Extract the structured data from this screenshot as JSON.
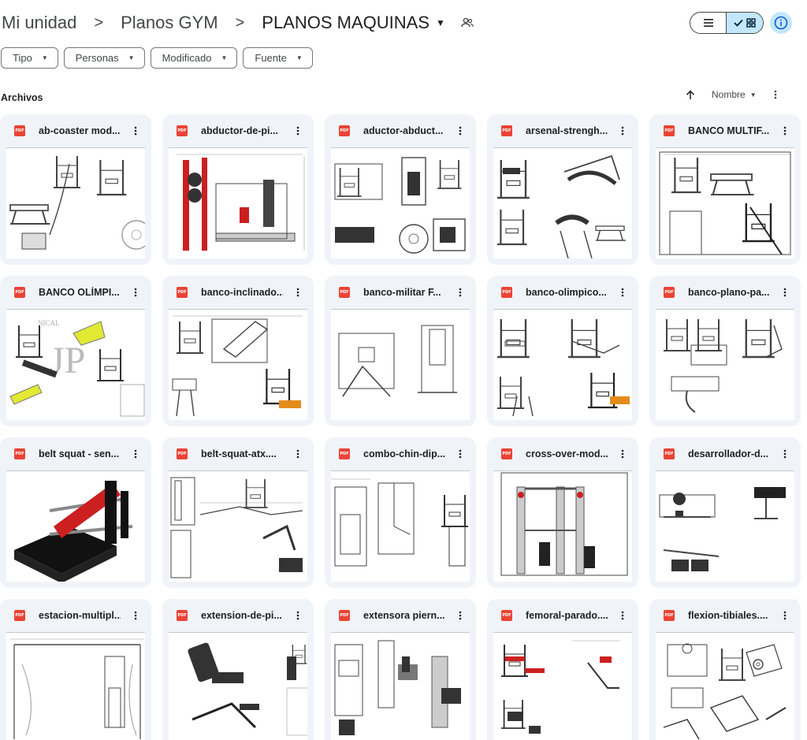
{
  "breadcrumb": {
    "items": [
      "Mi unidad",
      "Planos GYM",
      "PLANOS MAQUINAS"
    ],
    "separator": ">"
  },
  "view": {
    "mode": "grid",
    "list_icon": "list-icon",
    "grid_icon": "grid-icon",
    "check_icon": "check-icon",
    "info_icon": "info-icon"
  },
  "filters": [
    {
      "label": "Tipo"
    },
    {
      "label": "Personas"
    },
    {
      "label": "Modificado"
    },
    {
      "label": "Fuente"
    }
  ],
  "section": {
    "title": "Archivos"
  },
  "sort": {
    "label": "Nombre",
    "direction_icon": "arrow-up-icon"
  },
  "colors": {
    "accent": "#c2e7ff",
    "card_bg": "#f0f4f9",
    "pdf_red": "#ea4335",
    "machine_red": "#cc1f1f",
    "yellow": "#e1e933",
    "orange": "#e38c1b"
  },
  "files": [
    {
      "name": "ab-coaster mod...",
      "type": "PDF",
      "thumb": "abcoaster"
    },
    {
      "name": "abductor-de-pi...",
      "type": "PDF",
      "thumb": "abductor"
    },
    {
      "name": "aductor-abduct...",
      "type": "PDF",
      "thumb": "aductor"
    },
    {
      "name": "arsenal-strengh...",
      "type": "PDF",
      "thumb": "arsenal"
    },
    {
      "name": "BANCO MULTIF...",
      "type": "PDF",
      "thumb": "multif"
    },
    {
      "name": "BANCO OLÍMPI...",
      "type": "PDF",
      "thumb": "olimpi"
    },
    {
      "name": "banco-inclinado...",
      "type": "PDF",
      "thumb": "inclinado"
    },
    {
      "name": "banco-militar F...",
      "type": "PDF",
      "thumb": "militar"
    },
    {
      "name": "banco-olimpico...",
      "type": "PDF",
      "thumb": "olimpico"
    },
    {
      "name": "banco-plano-pa...",
      "type": "PDF",
      "thumb": "plano"
    },
    {
      "name": "belt squat - sen...",
      "type": "PDF",
      "thumb": "beltsquat"
    },
    {
      "name": "belt-squat-atx....",
      "type": "PDF",
      "thumb": "beltatx"
    },
    {
      "name": "combo-chin-dip...",
      "type": "PDF",
      "thumb": "chindip"
    },
    {
      "name": "cross-over-mod...",
      "type": "PDF",
      "thumb": "crossover"
    },
    {
      "name": "desarrollador-d...",
      "type": "PDF",
      "thumb": "desarrollador"
    },
    {
      "name": "estacion-multipl...",
      "type": "PDF",
      "thumb": "estacion"
    },
    {
      "name": "extension-de-pi...",
      "type": "PDF",
      "thumb": "extension"
    },
    {
      "name": "extensora piern...",
      "type": "PDF",
      "thumb": "extensora"
    },
    {
      "name": "femoral-parado....",
      "type": "PDF",
      "thumb": "femoral"
    },
    {
      "name": "flexion-tibiales....",
      "type": "PDF",
      "thumb": "tibiales"
    }
  ]
}
